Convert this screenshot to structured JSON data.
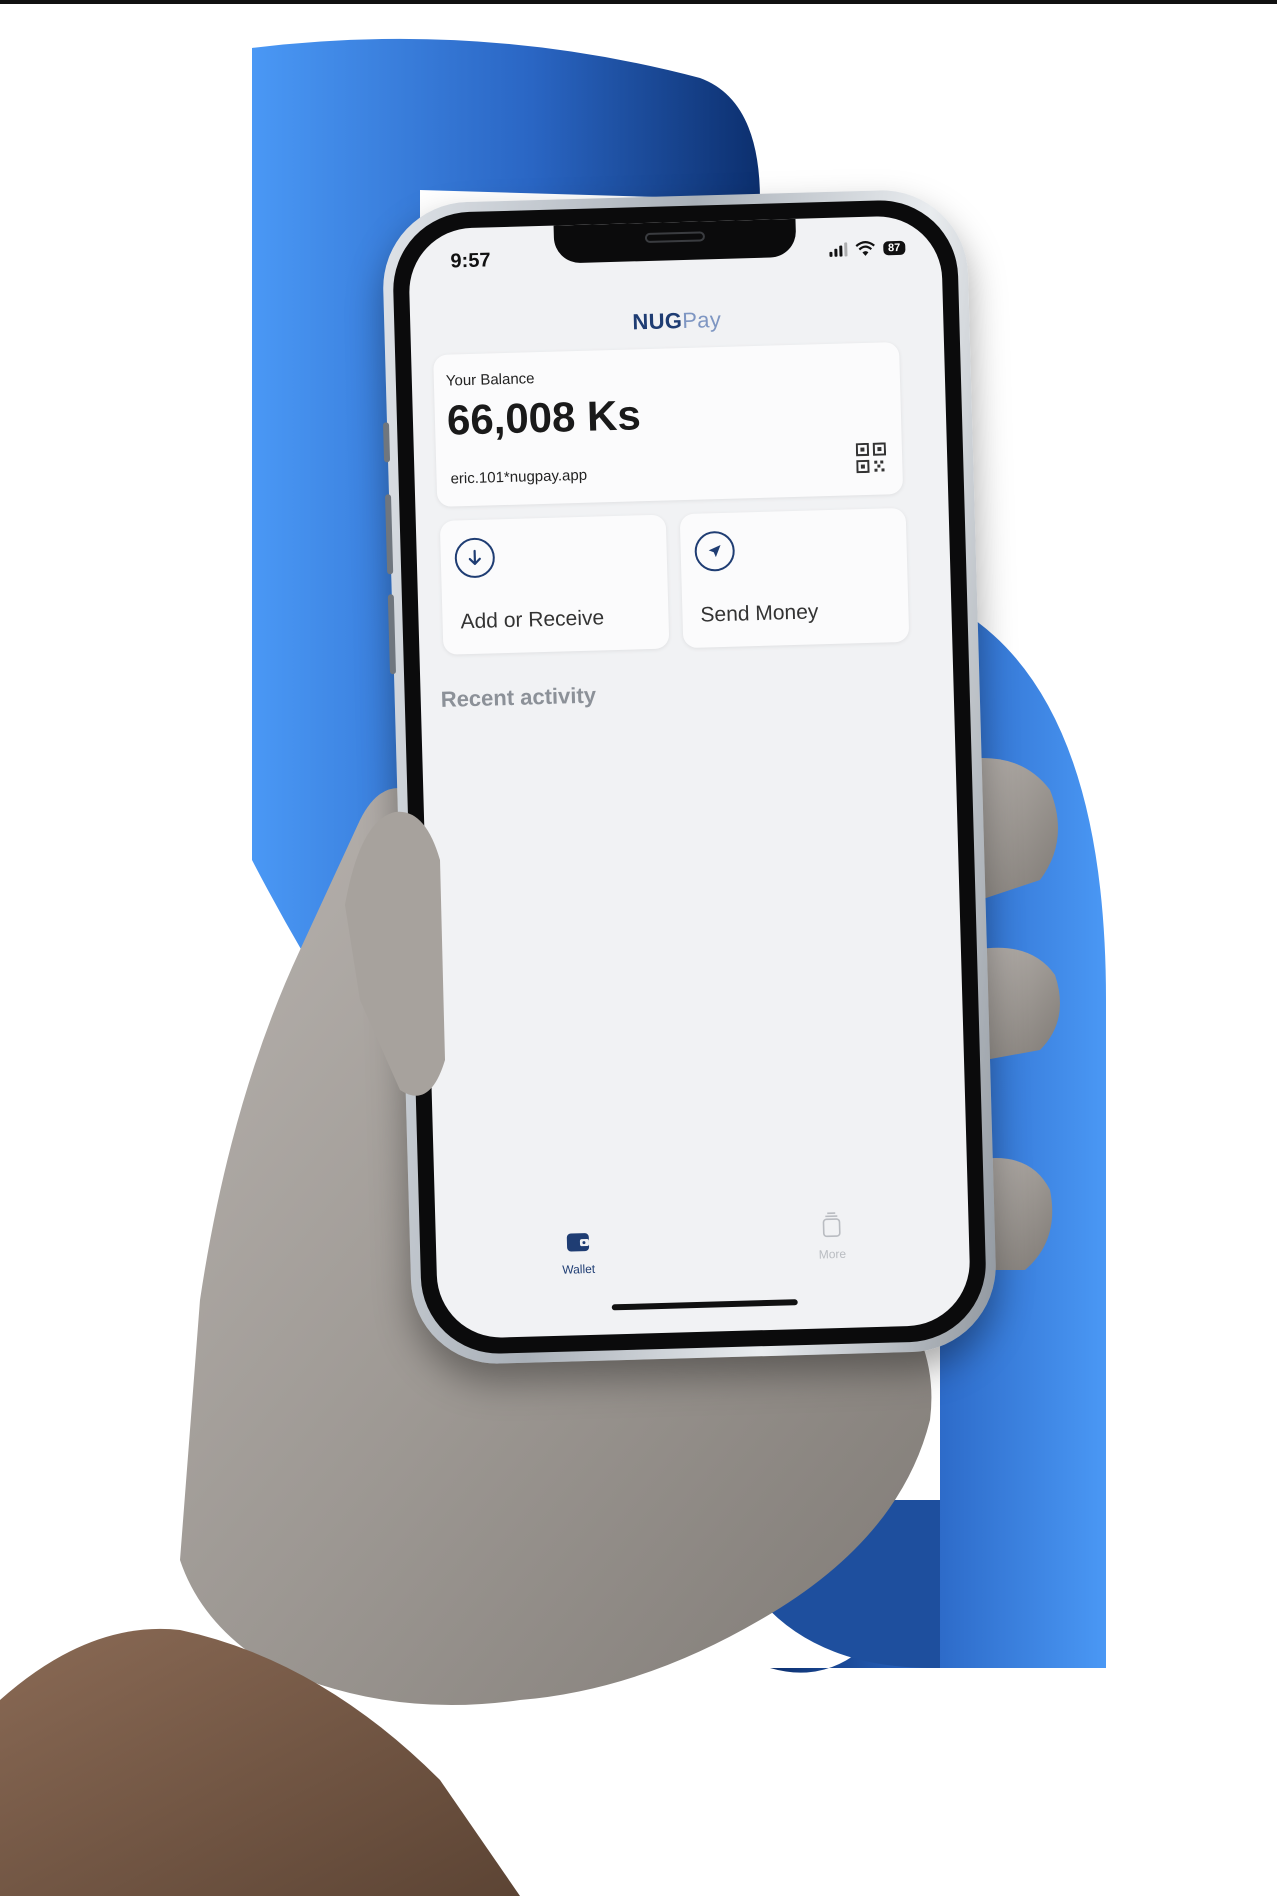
{
  "colors": {
    "brand_dark": "#1f3d73",
    "brand_light": "#7e96c2",
    "background_blue": "#4a98f5",
    "background_navy": "#0c2f6e"
  },
  "status_bar": {
    "time": "9:57",
    "battery": "87",
    "icons": [
      "signal-icon",
      "wifi-icon",
      "battery-icon"
    ]
  },
  "app": {
    "brand_primary": "NUG",
    "brand_secondary": "Pay"
  },
  "balance_card": {
    "label": "Your Balance",
    "value": "66,008 Ks",
    "handle": "eric.101*nugpay.app",
    "icon": "qr-code-icon"
  },
  "actions": [
    {
      "label": "Add or Receive",
      "icon": "arrow-down-circle-icon"
    },
    {
      "label": "Send Money",
      "icon": "send-arrow-icon"
    }
  ],
  "recent_activity": {
    "title": "Recent activity"
  },
  "tabs": [
    {
      "label": "Wallet",
      "icon": "wallet-icon",
      "active": true
    },
    {
      "label": "More",
      "icon": "more-icon",
      "active": false
    }
  ]
}
